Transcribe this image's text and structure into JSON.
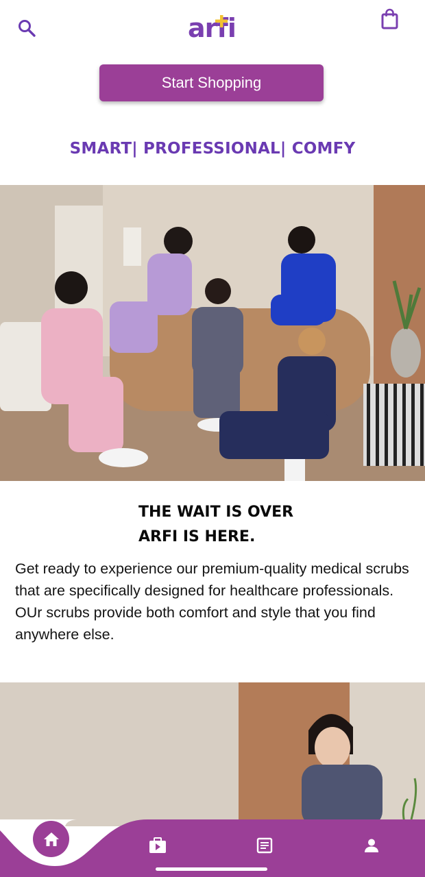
{
  "header": {
    "logo_text": "arfi",
    "search_icon": "search-icon",
    "cart_icon": "shopping-bag-icon"
  },
  "cta": {
    "label": "Start Shopping"
  },
  "tagline": "SMART| PROFESSIONAL| COMFY",
  "hero": {
    "image": "group-of-models-in-scrubs-photo"
  },
  "intro": {
    "headline_line1": "THE WAIT IS OVER",
    "headline_line2": "ARFI IS HERE.",
    "body": "Get ready to experience our premium-quality medical scrubs that are specifically designed for healthcare professionals. OUr scrubs provide both comfort and style that you find anywhere else."
  },
  "promo": {
    "image": "model-in-navy-scrubs-photo"
  },
  "bottom_nav": {
    "items": [
      {
        "icon": "home-icon",
        "active": true
      },
      {
        "icon": "video-bag-icon",
        "active": false
      },
      {
        "icon": "article-icon",
        "active": false
      },
      {
        "icon": "person-icon",
        "active": false
      }
    ]
  },
  "colors": {
    "brand_purple": "#7a3fb0",
    "button_plum": "#9b3f97",
    "tagline_purple": "#6a3ab2",
    "logo_yellow": "#f2c230"
  }
}
